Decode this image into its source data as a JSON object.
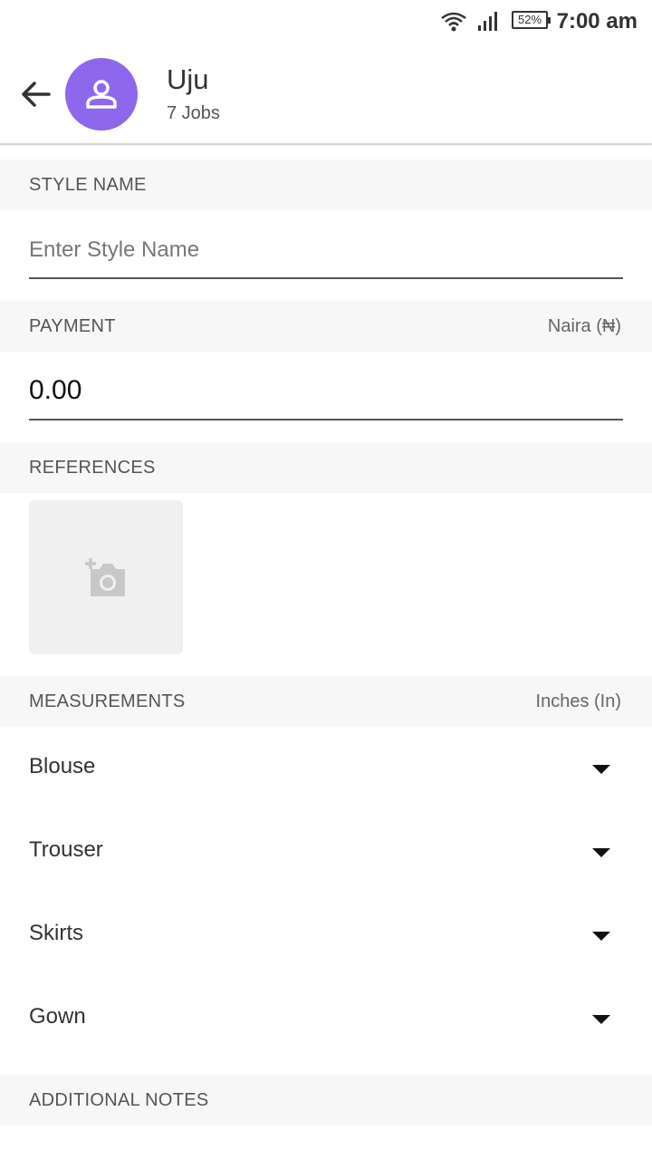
{
  "status_bar": {
    "battery": "52%",
    "time": "7:00 am",
    "icons": [
      "wifi-icon",
      "signal-icon",
      "battery-icon"
    ]
  },
  "header": {
    "back_icon": "arrow-left-icon",
    "avatar_icon": "person-icon",
    "name": "Uju",
    "jobs": "7 Jobs"
  },
  "style_name": {
    "section_label": "STYLE NAME",
    "placeholder": "Enter Style Name"
  },
  "payment": {
    "section_label": "PAYMENT",
    "currency": "Naira (₦)",
    "value": "0.00"
  },
  "references": {
    "section_label": "REFERENCES",
    "add_icon": "add-photo-icon"
  },
  "measurements": {
    "section_label": "MEASUREMENTS",
    "unit": "Inches (In)",
    "items": [
      "Blouse",
      "Trouser",
      "Skirts",
      "Gown"
    ]
  },
  "additional_notes": {
    "section_label": "ADDITIONAL NOTES"
  },
  "colors": {
    "avatar": "#8d67ec",
    "section_bg": "#f7f7f7",
    "add_photo_bg": "#f0f0f0"
  }
}
